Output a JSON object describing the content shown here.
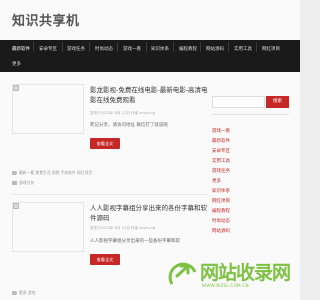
{
  "site": {
    "title": "知识共享机"
  },
  "nav": {
    "items": [
      "最新软件",
      "安卓专区",
      "游戏任务",
      "时尚动态",
      "游戏一看",
      "知识体系",
      "编程教程",
      "网站源码",
      "实用工具",
      "网红项目",
      "更多"
    ]
  },
  "posts": [
    {
      "title": "影龙影视-免费在线电影-最新电影-高清电影在线免费观看",
      "meta": "发布于2022年 6月 12日 作者 anyhung",
      "excerpt": "死记分享。请访问地址 微信打了就说呢",
      "button": "查看全文",
      "tags": "最新一看 美食生活 视频 手机软件 网红项目",
      "category": "游戏任务"
    },
    {
      "title": "人人影视字幕组分享出来的各份字幕和软件源码",
      "meta": "发布于2022年 6月 12日 作者 anyhung",
      "excerpt": "人人影视字幕组分享出来的一些备份字幕和软",
      "button": "查看全文",
      "tags": "更多 游戏",
      "category": ""
    }
  ],
  "sidebar": {
    "search_placeholder": "",
    "search_button": "搜索",
    "links": [
      "游戏一看",
      "最新软件",
      "安卓专区",
      "实用工具",
      "游戏任务",
      "更多",
      "知识体系",
      "网红项目",
      "编程教程",
      "时尚动态",
      "网站源码"
    ]
  },
  "watermark": {
    "text": "网站收录网",
    "sub": "WWW.WZSL.COM.CN"
  },
  "colors": {
    "accent": "#c62828",
    "nav_bg": "#1a1a1a",
    "watermark": "#7dc242"
  }
}
